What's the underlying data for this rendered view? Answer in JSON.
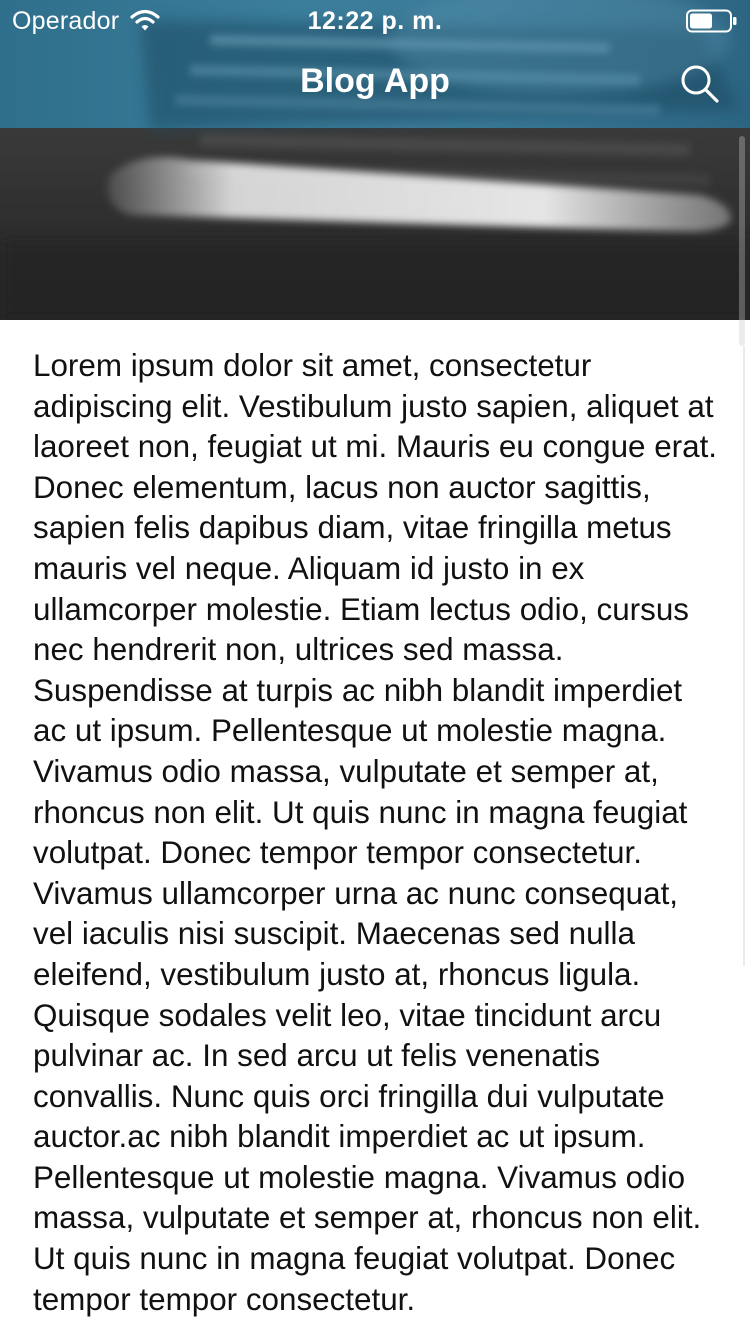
{
  "status_bar": {
    "carrier": "Operador",
    "time": "12:22 p. m."
  },
  "nav": {
    "title": "Blog App",
    "search_icon": "search-icon"
  },
  "hero": {
    "image": "blurred-laptop-keyboard-photo"
  },
  "article": {
    "body": "Lorem ipsum dolor sit amet, consectetur adipiscing elit. Vestibulum justo sapien, aliquet at laoreet non, feugiat ut mi. Mauris eu congue erat. Donec elementum, lacus non auctor sagittis, sapien felis dapibus diam, vitae fringilla metus mauris vel neque. Aliquam id justo in ex ullamcorper molestie. Etiam lectus odio, cursus nec hendrerit non, ultrices sed massa. Suspendisse at turpis ac nibh blandit imperdiet ac ut ipsum. Pellentesque ut molestie magna. Vivamus odio massa, vulputate et semper at, rhoncus non elit. Ut quis nunc in magna feugiat volutpat. Donec tempor tempor consectetur. Vivamus ullamcorper urna ac nunc consequat, vel iaculis nisi suscipit. Maecenas sed nulla eleifend, vestibulum justo at, rhoncus ligula. Quisque sodales velit leo, vitae tincidunt arcu pulvinar ac. In sed arcu ut felis venenatis convallis. Nunc quis orci fringilla dui vulputate auctor.ac nibh blandit imperdiet ac ut ipsum. Pellentesque ut molestie magna. Vivamus odio massa, vulputate et semper at, rhoncus non elit. Ut quis nunc in magna feugiat volutpat. Donec tempor tempor consectetur."
  },
  "colors": {
    "nav_tint": "#3b7e9c",
    "text": "#111111",
    "background": "#ffffff"
  }
}
